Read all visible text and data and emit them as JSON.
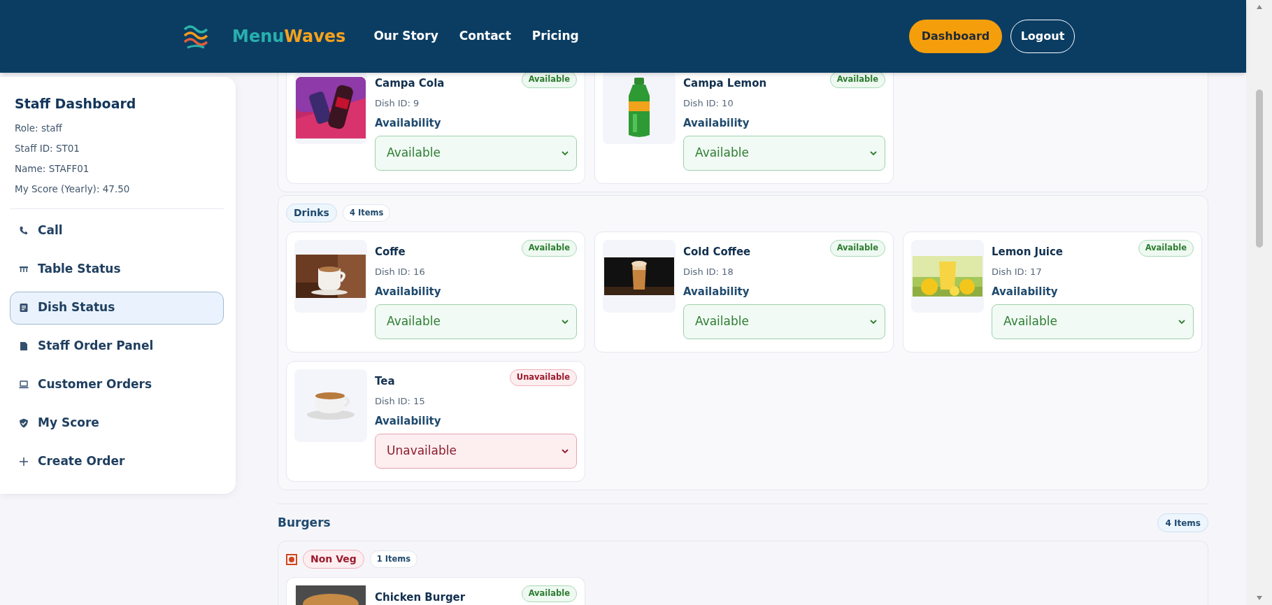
{
  "header": {
    "brand": {
      "first": "Menu",
      "second": "Waves"
    },
    "nav": [
      "Our Story",
      "Contact",
      "Pricing"
    ],
    "buttons": [
      {
        "label": "Dashboard",
        "kind": "primary"
      },
      {
        "label": "Logout",
        "kind": "outline"
      }
    ]
  },
  "sidebar": {
    "title": "Staff Dashboard",
    "info": [
      "Role: staff",
      "Staff ID: ST01",
      "Name: STAFF01",
      "My Score (Yearly): 47.50"
    ],
    "items": [
      {
        "label": "Call",
        "selected": false
      },
      {
        "label": "Table Status",
        "selected": false
      },
      {
        "label": "Dish Status",
        "selected": true
      },
      {
        "label": "Staff Order Panel",
        "selected": false
      },
      {
        "label": "Customer Orders",
        "selected": false
      },
      {
        "label": "My Score",
        "selected": false
      },
      {
        "label": "Create Order",
        "selected": false
      }
    ]
  },
  "sections": [
    {
      "items": [
        {
          "name": "Campa Cola",
          "dish_id": "Dish ID: 9",
          "available": true,
          "status": "Available",
          "field_label": "Availability",
          "selection": "Available"
        },
        {
          "name": "Campa Lemon",
          "dish_id": "Dish ID: 10",
          "available": true,
          "status": "Available",
          "field_label": "Availability",
          "selection": "Available"
        }
      ]
    },
    {
      "category": "Drinks",
      "count": "4 Items",
      "items": [
        {
          "name": "Coffe",
          "dish_id": "Dish ID: 16",
          "available": true,
          "status": "Available",
          "field_label": "Availability",
          "selection": "Available"
        },
        {
          "name": "Cold Coffee",
          "dish_id": "Dish ID: 18",
          "available": true,
          "status": "Available",
          "field_label": "Availability",
          "selection": "Available"
        },
        {
          "name": "Lemon Juice",
          "dish_id": "Dish ID: 17",
          "available": true,
          "status": "Available",
          "field_label": "Availability",
          "selection": "Available"
        },
        {
          "name": "Tea",
          "dish_id": "Dish ID: 15",
          "available": false,
          "status": "Unavailable",
          "field_label": "Availability",
          "selection": "Unavailable"
        }
      ]
    }
  ],
  "burgers": {
    "title": "Burgers",
    "count": "4 Items",
    "groups": [
      {
        "veg": false,
        "label": "Non Veg",
        "count": "1 Items",
        "items": [
          {
            "name": "Chicken Burger",
            "available": true,
            "status": "Available"
          }
        ]
      }
    ]
  }
}
